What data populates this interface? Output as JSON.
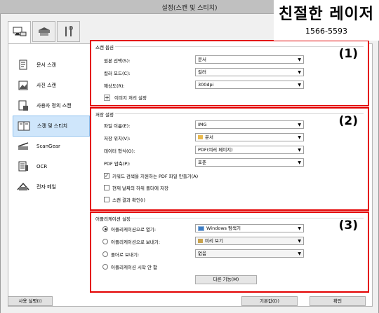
{
  "window": {
    "title": "설정(스캔 및 스티치)"
  },
  "brand": {
    "name": "친절한 레이저",
    "phone": "1566-5593"
  },
  "tabs": [
    {
      "icon": "scanner-computer-icon"
    },
    {
      "icon": "scanner-icon"
    },
    {
      "icon": "tools-icon"
    }
  ],
  "sidebar": {
    "items": [
      {
        "label": "문서 스캔",
        "icon": "document-scan-icon"
      },
      {
        "label": "사진 스캔",
        "icon": "photo-scan-icon"
      },
      {
        "label": "사용자 정의 스캔",
        "icon": "custom-scan-icon"
      },
      {
        "label": "스캔 및 스티치",
        "icon": "scan-stitch-icon"
      },
      {
        "label": "ScanGear",
        "icon": "scangear-icon"
      },
      {
        "label": "OCR",
        "icon": "ocr-icon"
      },
      {
        "label": "전자 메일",
        "icon": "email-icon"
      }
    ]
  },
  "scan_options": {
    "title": "스캔 옵션",
    "number": "(1)",
    "source_label": "원본 선택(S):",
    "source_value": "문서",
    "color_label": "컬러 모드(C):",
    "color_value": "컬러",
    "resolution_label": "해상도(R):",
    "resolution_value": "300dpi",
    "image_processing_label": "이미지 처리 설정"
  },
  "save_settings": {
    "title": "저장 설정",
    "number": "(2)",
    "filename_label": "파일 이름(E):",
    "filename_value": "IMG",
    "save_in_label": "저장 위치(V):",
    "save_in_value": "문서",
    "data_format_label": "데이터 형식(O):",
    "data_format_value": "PDF(여러 페이지)",
    "pdf_compression_label": "PDF 압축(P):",
    "pdf_compression_value": "표준",
    "check_keyword_label": "키워드 검색을 지원하는 PDF 파일 만들기(A)",
    "check_keyword_checked": true,
    "check_subfolder_label": "현재 날짜의 하위 폴더에 저장",
    "check_subfolder_checked": false,
    "check_confirm_label": "스캔 결과 확인(I)",
    "check_confirm_checked": false
  },
  "app_settings": {
    "title": "어플리케이션 설정",
    "number": "(3)",
    "open_app_label": "어플리케이션으로 열기:",
    "open_app_value": "Windows 탐색기",
    "send_app_label": "어플리케이션으로 보내기:",
    "send_app_value": "미리 보기",
    "send_folder_label": "폴더로 보내기:",
    "send_folder_value": "없음",
    "no_app_label": "어플리케이션 시작 안 함",
    "more_functions_label": "다른 기능(M)",
    "selected": "open_app"
  },
  "footer": {
    "instructions_label": "사용 설명(I)",
    "defaults_label": "기본값(D)",
    "ok_label": "확인"
  }
}
